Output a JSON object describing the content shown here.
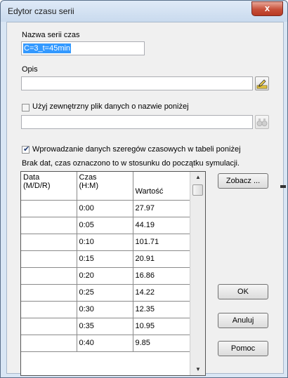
{
  "window": {
    "title": "Edytor czasu serii",
    "close_label": "x"
  },
  "series_name": {
    "label": "Nazwa serii czas",
    "value": "C=3_t=45min"
  },
  "description": {
    "label": "Opis",
    "value": ""
  },
  "external_file": {
    "checkbox_label": "Użyj zewnętrzny plik danych o nazwie poniżej",
    "checked": false,
    "value": ""
  },
  "table_entry": {
    "checkbox_label": "Wprowadzanie danych szeregów czasowych w tabeli poniżej",
    "checked": true,
    "note": "Brak dat, czas oznaczono to w stosunku do początku symulacji."
  },
  "table": {
    "headers": [
      "Data\n(M/D/R)",
      "Czas\n(H:M)",
      "Wartość"
    ],
    "rows": [
      {
        "date": "",
        "time": "0:00",
        "value": "27.97"
      },
      {
        "date": "",
        "time": "0:05",
        "value": "44.19"
      },
      {
        "date": "",
        "time": "0:10",
        "value": "101.71"
      },
      {
        "date": "",
        "time": "0:15",
        "value": "20.91"
      },
      {
        "date": "",
        "time": "0:20",
        "value": "16.86"
      },
      {
        "date": "",
        "time": "0:25",
        "value": "14.22"
      },
      {
        "date": "",
        "time": "0:30",
        "value": "12.35"
      },
      {
        "date": "",
        "time": "0:35",
        "value": "10.95"
      },
      {
        "date": "",
        "time": "0:40",
        "value": "9.85"
      }
    ]
  },
  "buttons": {
    "view": "Zobacz ...",
    "ok": "OK",
    "cancel": "Anuluj",
    "help": "Pomoc"
  },
  "icons": {
    "edit": "pencil-edit-icon",
    "browse": "binoculars-icon"
  }
}
